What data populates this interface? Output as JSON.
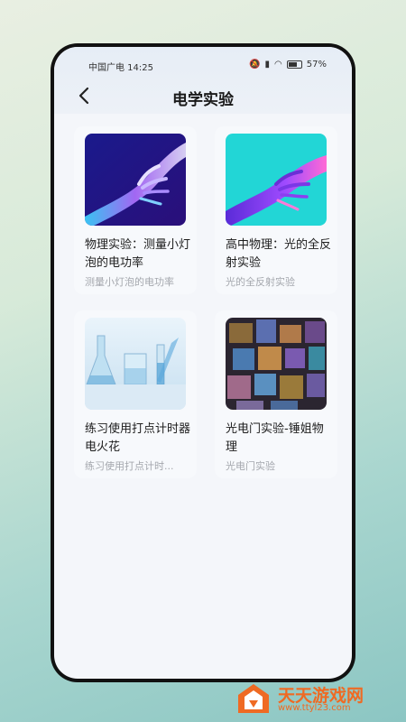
{
  "status_bar": {
    "carrier_time": "中国广电 14:25",
    "battery": "57%"
  },
  "header": {
    "title": "电学实验"
  },
  "cards": [
    {
      "title": "物理实验：测量小灯泡的电功率",
      "subtitle": "测量小灯泡的电功率"
    },
    {
      "title": "高中物理：光的全反射实验",
      "subtitle": "光的全反射实验"
    },
    {
      "title": "练习使用打点计时器电火花",
      "subtitle": "练习使用打点计时..."
    },
    {
      "title": "光电门实验-锤姐物理",
      "subtitle": "光电门实验"
    }
  ],
  "watermark": {
    "name": "天天游戏网",
    "url": "www.ttyl23.com"
  },
  "colors": {
    "accent": "#ef6a23",
    "frame": "#111111",
    "background": "#f4f6fa"
  }
}
